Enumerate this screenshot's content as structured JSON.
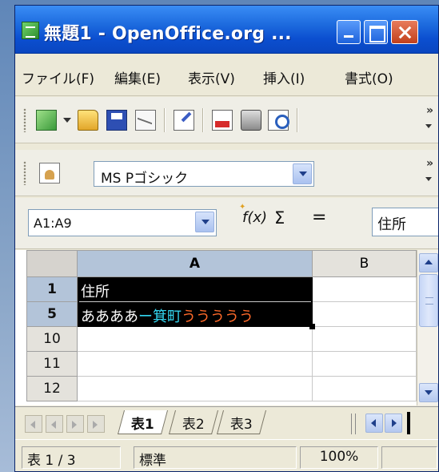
{
  "window": {
    "title": "無題1 - OpenOffice.org ..."
  },
  "menubar": {
    "items": [
      "ファイル(F)",
      "編集(E)",
      "表示(V)",
      "挿入(I)",
      "書式(O)"
    ]
  },
  "toolbar": {
    "font_name": "MS Pゴシック",
    "overflow": "»"
  },
  "formula_bar": {
    "name_box": "A1:A9",
    "fx_label": "f(x)",
    "sum_label": "Σ",
    "equals_label": "=",
    "input_value": "住所"
  },
  "sheet": {
    "columns": [
      "A",
      "B"
    ],
    "rows": [
      {
        "header": "1",
        "a_parts": [
          {
            "text": "住所",
            "color": "#ffffff"
          }
        ],
        "selected": true
      },
      {
        "header": "5",
        "a_parts": [
          {
            "text": "ああああ",
            "color": "#ffffff"
          },
          {
            "text": "ー箕町",
            "color": "#33d6f0"
          },
          {
            "text": "ううううう",
            "color": "#ff6a2a"
          }
        ],
        "selected": true
      },
      {
        "header": "10",
        "a_parts": [],
        "selected": false
      },
      {
        "header": "11",
        "a_parts": [],
        "selected": false
      },
      {
        "header": "12",
        "a_parts": [],
        "selected": false
      }
    ]
  },
  "tabs": [
    "表1",
    "表2",
    "表3"
  ],
  "statusbar": {
    "sheet_info": "表 1 / 3",
    "page_style": "標準",
    "zoom": "100%"
  },
  "colors": {
    "titlebar": "#0b4fd0",
    "selection": "#000000",
    "header_selected": "#b3c4d9"
  }
}
